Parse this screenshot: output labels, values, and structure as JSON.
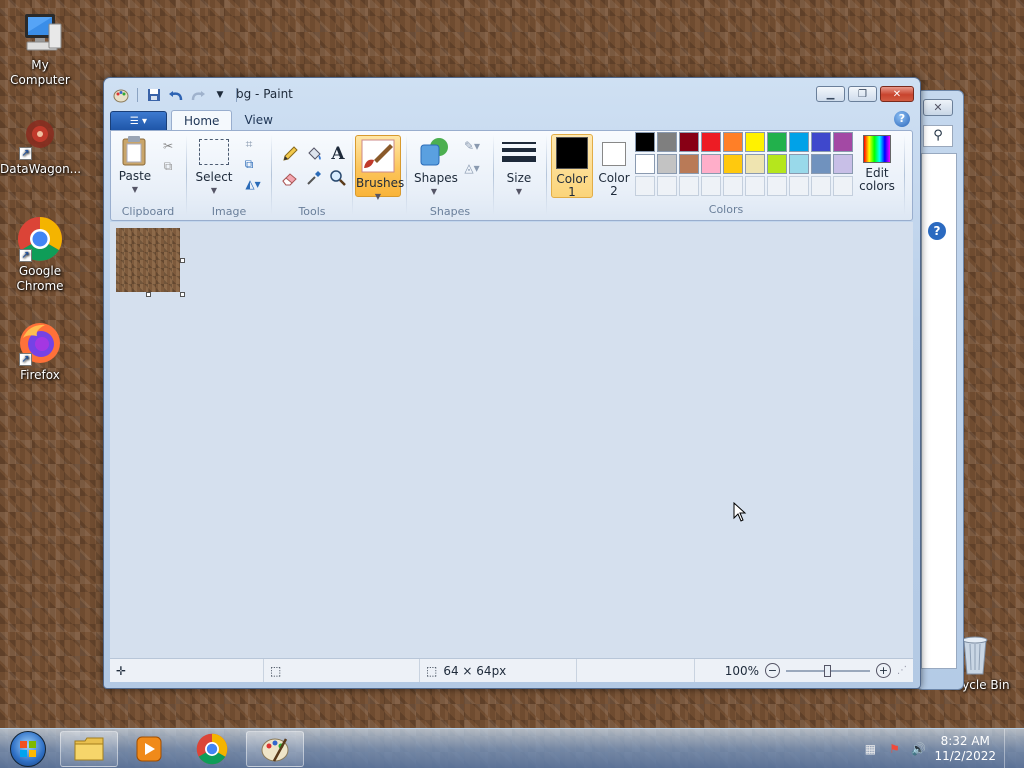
{
  "desktop": {
    "icons": [
      {
        "label": "My Computer"
      },
      {
        "label": "DataWagon..."
      },
      {
        "label": "Google Chrome"
      },
      {
        "label": "Firefox"
      },
      {
        "label": "Recycle Bin"
      }
    ]
  },
  "paint": {
    "title": "bg - Paint",
    "tabs": [
      {
        "label": "Home"
      },
      {
        "label": "View"
      }
    ],
    "ribbon": {
      "clipboard": {
        "label": "Clipboard",
        "paste": "Paste"
      },
      "image": {
        "label": "Image",
        "select": "Select"
      },
      "tools": {
        "label": "Tools"
      },
      "brushes": "Brushes",
      "shapes": {
        "label": "Shapes",
        "button": "Shapes"
      },
      "size": "Size",
      "colors": {
        "label": "Colors",
        "color1_line1": "Color",
        "color1_line2": "1",
        "color2_line1": "Color",
        "color2_line2": "2",
        "edit_line1": "Edit",
        "edit_line2": "colors",
        "color1": "#000000",
        "color2": "#ffffff",
        "palette_row1": [
          "#000000",
          "#7f7f7f",
          "#880015",
          "#ed1c24",
          "#ff7f27",
          "#fff200",
          "#22b14c",
          "#00a2e8",
          "#3f48cc",
          "#a349a4"
        ],
        "palette_row2": [
          "#ffffff",
          "#c3c3c3",
          "#b97a57",
          "#ffaec9",
          "#ffc90e",
          "#efe4b0",
          "#b5e61d",
          "#99d9ea",
          "#7092be",
          "#c8bfe7"
        ]
      }
    },
    "status": {
      "dimensions": "64 × 64px",
      "zoom": "100%"
    }
  },
  "taskbar": {
    "time": "8:32 AM",
    "date": "11/2/2022"
  }
}
